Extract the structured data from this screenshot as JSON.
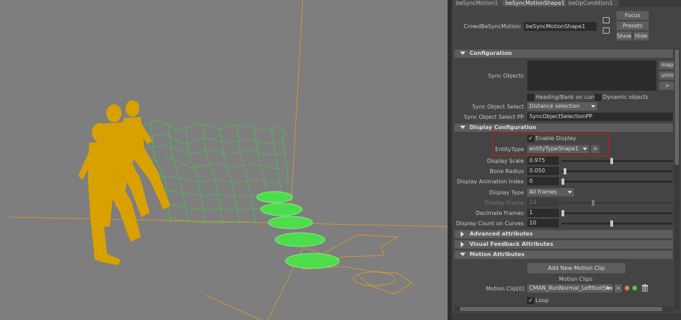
{
  "tabs": [
    "beSyncMotion1",
    "beSyncMotionShape1",
    "beOpCondition1"
  ],
  "header": {
    "node_label": "CrowdBeSyncMotion:",
    "node_value": "beSyncMotionShape1",
    "focus_label": "Focus",
    "presets_label": "Presets",
    "show_label": "Show",
    "hide_label": "Hide"
  },
  "configuration": {
    "title": "Configuration",
    "sync_objects_label": "Sync Objects",
    "map_label": "map",
    "unmap_label": "unm",
    "more_label": ">",
    "heading_bank_label": "Heading/Bank on curve",
    "dynamic_objects_label": "Dynamic objects",
    "sync_object_select_label": "Sync Object Select",
    "sync_object_select_value": "Distance selection",
    "sync_object_select_pp_label": "Sync Object Select PP",
    "sync_object_select_pp_value": "SyncObjectSelectionPP"
  },
  "display_configuration": {
    "title": "Display Configuration",
    "enable_display_label": "Enable Display",
    "enable_display_checked": true,
    "entity_type_label": "EntityType",
    "entity_type_value": "entityTypeShape1",
    "entity_more_label": ">",
    "display_scale_label": "Display Scale",
    "display_scale_value": "0.975",
    "display_scale_pos": 0.45,
    "bone_radius_label": "Bone Radius",
    "bone_radius_value": "0.050",
    "bone_radius_pos": 0.02,
    "display_anim_index_label": "Display Animation Index",
    "display_anim_index_value": "0",
    "display_anim_index_pos": 0.0,
    "display_type_label": "Display Type",
    "display_type_value": "All frames",
    "display_frame_label": "Display Frame",
    "display_frame_value": "24",
    "display_frame_pos": 0.28,
    "decimate_frames_label": "Decimate Frames",
    "decimate_frames_value": "1",
    "decimate_frames_pos": 0.0,
    "display_count_label": "Display Count on Curves",
    "display_count_value": "10",
    "display_count_pos": 0.45
  },
  "advanced_title": "Advanced attributes",
  "visual_feedback_title": "Visual Feedback Attributes",
  "motion_attributes": {
    "title": "Motion Attributes",
    "add_clip_label": "Add New Motion Clip",
    "motion_clips_label": "Motion Clips",
    "motion_clip0_label": "Motion Clip[0]",
    "motion_clip0_value": "CMAN_RunNormal_LeftfootShape",
    "more_label": ">",
    "loop_label": "Loop",
    "loop_checked": true
  },
  "colors": {
    "character": "#d9a100",
    "wireframe": "#33e833",
    "disc": "#44ee44",
    "curve": "#e8a020",
    "highlight_box": "#dd1111",
    "orange_dot": "#e08040",
    "green_dot": "#44cc44"
  },
  "icons": {
    "trash": "trash-icon",
    "input_connection": "input-connection-icon",
    "output_connection": "output-connection-icon"
  }
}
